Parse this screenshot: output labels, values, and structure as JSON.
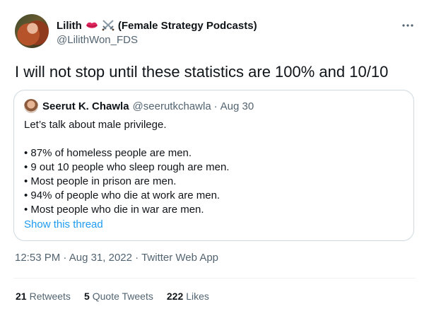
{
  "author": {
    "display_name": "Lilith",
    "display_name_suffix": "(Female Strategy Podcasts)",
    "emojis": [
      "lips-icon",
      "crossed-swords-icon"
    ],
    "handle": "@LilithWon_FDS"
  },
  "tweet": {
    "text": "I will not stop until these statistics are 100% and 10/10"
  },
  "quoted": {
    "name": "Seerut K. Chawla",
    "handle": "@seerutkchawla",
    "separator": "·",
    "date": "Aug 30",
    "intro": "Let’s talk about male privilege.",
    "bullets": [
      "• 87% of homeless people are men.",
      "• 9 out 10 people who sleep rough are men.",
      "• Most people in prison are men.",
      "• 94% of people who die at work are men.",
      "• Most people who die in war are men."
    ],
    "show_thread": "Show this thread"
  },
  "meta": {
    "time": "12:53 PM",
    "separator": "·",
    "date": "Aug 31, 2022",
    "source": "Twitter Web App"
  },
  "stats": {
    "retweets_count": "21",
    "retweets_label": "Retweets",
    "quotes_count": "5",
    "quotes_label": "Quote Tweets",
    "likes_count": "222",
    "likes_label": "Likes"
  },
  "colors": {
    "link": "#1d9bf0",
    "secondary_text": "#536471",
    "border": "#cfd9de"
  }
}
